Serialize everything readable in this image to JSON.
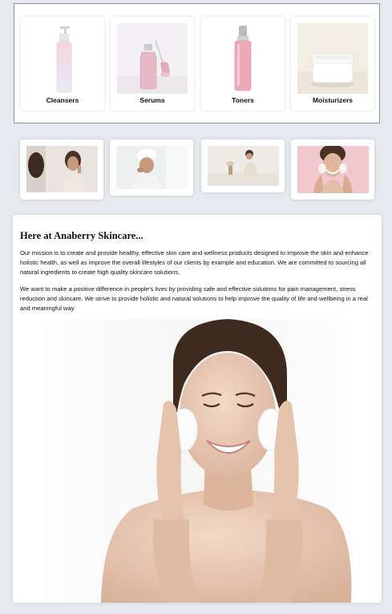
{
  "categories": [
    {
      "label": "Cleansers",
      "image": "cleanser-bottle"
    },
    {
      "label": "Serums",
      "image": "serum-dropper-bottle"
    },
    {
      "label": "Toners",
      "image": "toner-bottle"
    },
    {
      "label": "Moisturizers",
      "image": "moisturizer-jar"
    }
  ],
  "gallery": [
    {
      "image": "woman-touching-face-photo"
    },
    {
      "image": "woman-with-towel-photo"
    },
    {
      "image": "woman-relaxing-bedroom-photo"
    },
    {
      "image": "woman-washing-face-photo"
    }
  ],
  "about": {
    "title": "Here at Anaberry Skincare...",
    "paragraph_1": "Our mission is to create and provide healthy, effective skin care and wellness products designed to improve the skin and enhance holistic health, as well as improve the overall lifestyles of our clients by example and education. We are committed to sourcing all natural ingredients to create high quality skincare solutions.",
    "paragraph_2": "We want to make a positive difference in people’s lives by providing safe and effective solutions for pain management, stress reduction and skincare. We strive to provide holistic and natural solutions to help improve the quality of life and wellbeing in a real and meaningful way",
    "hero_image": "smiling-woman-foam-cleanser-photo"
  },
  "colors": {
    "page_background": "#e6e9ee",
    "card_background": "#ffffff",
    "panel_border": "#8f959c"
  }
}
